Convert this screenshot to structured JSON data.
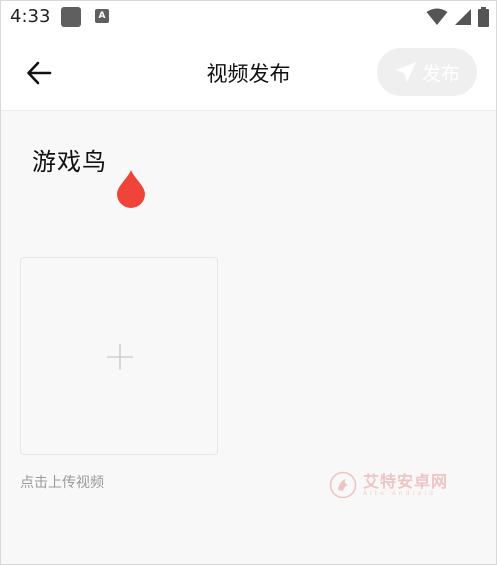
{
  "status_bar": {
    "time": "4:33",
    "app_badge_letter": "A",
    "icons": [
      "app-notification-icon",
      "font-app-icon",
      "wifi-icon",
      "signal-icon",
      "battery-icon"
    ]
  },
  "app_bar": {
    "title": "视频发布",
    "publish_label": "发布",
    "back_icon": "arrow-left-icon",
    "publish_icon": "send-icon"
  },
  "content": {
    "brand_name": "游戏鸟",
    "upload_hint": "点击上传视频"
  },
  "watermark": {
    "text": "艾特安卓网",
    "subtext": "Aite Android"
  },
  "colors": {
    "accent_drop": "#f0443a",
    "publish_disabled_bg": "#efefef",
    "page_bg": "#f8f8f8"
  }
}
